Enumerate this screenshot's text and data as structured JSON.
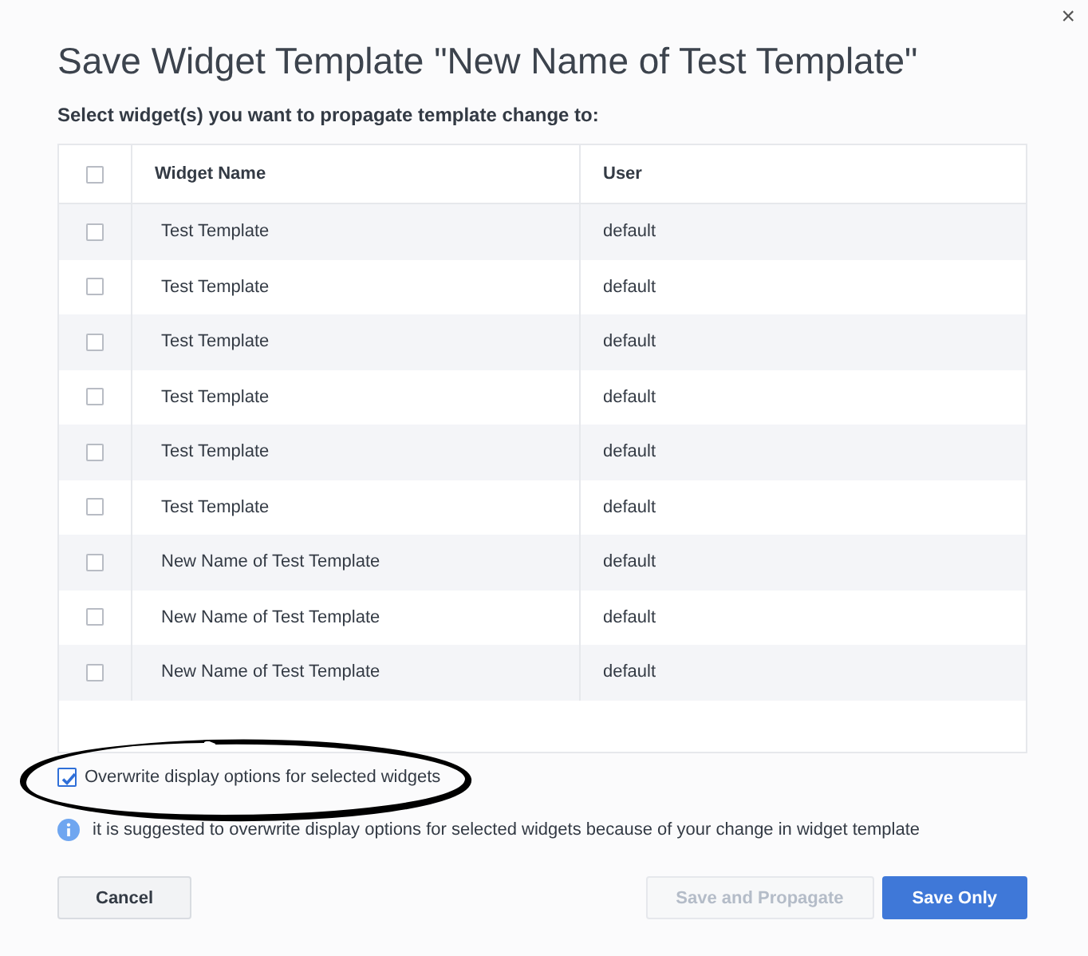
{
  "dialog": {
    "title": "Save Widget Template \"New Name of Test Template\"",
    "close": "×",
    "instruction": "Select widget(s) you want to propagate template change to:"
  },
  "table": {
    "select_all_checked": false,
    "columns": [
      "Widget Name",
      "User"
    ],
    "rows": [
      {
        "checked": false,
        "name": "Test Template",
        "user": "default"
      },
      {
        "checked": false,
        "name": "Test Template",
        "user": "default"
      },
      {
        "checked": false,
        "name": "Test Template",
        "user": "default"
      },
      {
        "checked": false,
        "name": "Test Template",
        "user": "default"
      },
      {
        "checked": false,
        "name": "Test Template",
        "user": "default"
      },
      {
        "checked": false,
        "name": "Test Template",
        "user": "default"
      },
      {
        "checked": false,
        "name": "New Name of Test Template",
        "user": "default"
      },
      {
        "checked": false,
        "name": "New Name of Test Template",
        "user": "default"
      },
      {
        "checked": false,
        "name": "New Name of Test Template",
        "user": "default"
      }
    ]
  },
  "overwrite_option": {
    "label": "Overwrite display options for selected widgets",
    "checked": true,
    "circled": true
  },
  "info": "it is suggested to overwrite display options for selected widgets because of your change in widget template",
  "buttons": [
    {
      "label": "Cancel",
      "kind": "secondary",
      "disabled": false
    },
    {
      "label": "Save and Propagate",
      "kind": "secondary",
      "disabled": true
    },
    {
      "label": "Save Only",
      "kind": "primary",
      "disabled": false
    }
  ]
}
